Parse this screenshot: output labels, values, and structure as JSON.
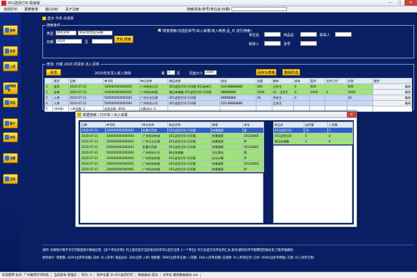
{
  "window": {
    "title": "451送货打印-极速版",
    "minimize": "—",
    "maximize": "□",
    "close": "✕"
  },
  "menu": {
    "items": [
      "当前打印",
      "报表帐单",
      "窗口(W)",
      "关于注册"
    ],
    "search_label": "搜索货单(单号/单位名/日期)"
  },
  "sidebar": {
    "items": [
      "查单",
      "发货",
      "入货",
      "销售报表",
      "货品",
      "客户",
      "供货",
      "设置",
      "注册"
    ]
  },
  "breadcrumb": "显示 今年 出货单",
  "filter": {
    "legend": "搜索条件",
    "type_label": "类型",
    "type_value": "所有货单",
    "keyword_placeholder": "单号/单位名/日期",
    "date_label": "日期",
    "date_from": "2020",
    "date_to_label": "至",
    "date_to": "",
    "search_button": "开始 搜索",
    "right_checkbox": "✓",
    "right_hint": "随意搜索(勾选后单号/出入库量/收入等按 品_日 进行搜索)",
    "unit_label": "单位名",
    "unit_value": "",
    "phone_label": "联系人",
    "phone_value": "",
    "goods_label": "商品名",
    "goods_value": "",
    "maker_label": "制单人",
    "maker_value": "",
    "remark_label": "货号",
    "remark_value": ""
  },
  "list": {
    "legend": "查找: 日期 2020 的货单 出入货单",
    "all_button": "全选",
    "page_info": "2020年年货入新入物资",
    "page_label": "第",
    "page_value": "1",
    "page_unit": "页",
    "page_size_label": "页面大小",
    "page_size_value": "2000",
    "export_button": "另存为表格",
    "delete_button": "删除所选",
    "columns": [
      "",
      "类型",
      "日期",
      "单号码",
      "单位名称",
      "商品名称",
      "地址",
      "金额",
      "制单",
      "成本",
      "盈利",
      "应付已付",
      "欠款",
      "操作"
    ],
    "rows": [
      {
        "idx": "1",
        "type": "出库",
        "date": "2020-07-21",
        "no": "100000000000003",
        "unit": "广州科技公司",
        "goods": "451送货打印-打印版-451送单打",
        "addr": "020-88888888",
        "amount": "600",
        "maker": "王先生",
        "cost": "0",
        "profit": "600",
        "paid": "",
        "owe": "600",
        "op": "编改"
      },
      {
        "idx": "2",
        "type": "出库",
        "date": "2020-07-21",
        "no": "100000000000002",
        "unit": "广州科技有限",
        "goods": "笔记本电脑 451送货打印-打印版",
        "addr": "88888888",
        "amount": "3400",
        "maker": "刘... 王先生",
        "cost": "0",
        "profit": "3400",
        "paid": "0",
        "owe": "3400",
        "op": "编改"
      },
      {
        "idx": "3",
        "type": "入库",
        "date": "2020-07-21",
        "no": "500000000000003",
        "unit": "广州天达光源",
        "goods": "451送货打印-打印版",
        "addr": "88888888",
        "amount": "30",
        "maker": "李先生",
        "cost": "0",
        "profit": "",
        "paid": "",
        "owe": "30",
        "op": "编改"
      },
      {
        "idx": "4",
        "type": "入库",
        "date": "2020-07-21",
        "no": "500000000000004",
        "unit": "广州科技公司",
        "goods": "451送货打印-打印版",
        "addr": "020-88888888",
        "amount": "",
        "maker": "王先生",
        "cost": "",
        "profit": "",
        "paid": "",
        "owe": "",
        "op": "编改"
      },
      {
        "idx": "5",
        "type": "(共4条)",
        "date": "入库总数: 2",
        "no": "出货总数: 4000",
        "unit": "欠数总计: 0",
        "goods": "",
        "addr": "",
        "amount": "",
        "maker": "",
        "cost": "",
        "profit": "",
        "paid": "",
        "owe": "",
        "op": ""
      }
    ]
  },
  "popup": {
    "title": "数据搜索 / 打印单 / 出入库量",
    "close": "✕",
    "columns": [
      "日期",
      "单号码",
      "单位名称",
      "商品名称",
      "规格",
      "单位"
    ],
    "rows": [
      {
        "date": "2020-07-21",
        "no": "100000000000003",
        "unit": "彩墨大药房",
        "goods": "451送货打印-打印版",
        "spec": "快捷搜索",
        "u": "盒"
      },
      {
        "date": "2020-07-21",
        "no": "100000000000004",
        "unit": "广州科技有限",
        "goods": "451送货打印-打印版",
        "spec": "快捷搜索",
        "u": "20110805"
      },
      {
        "date": "2020-07-21",
        "no": "100000000000002",
        "unit": "广州天达光源",
        "goods": "451送货打印-打印版",
        "spec": "快捷搜索",
        "u": "件"
      },
      {
        "date": "2020-07-21",
        "no": "500000000000003",
        "unit": "彩墨大药房",
        "goods": "451送货打印-打印版",
        "spec": "快捷搜索",
        "u": "20120805"
      },
      {
        "date": "2020-07-21",
        "no": "500000000000004",
        "unit": "广州科技公司",
        "goods": "笔记本电脑",
        "spec": "记忆保存",
        "u": "套"
      },
      {
        "date": "2020-07-21",
        "no": "100000000000002",
        "unit": "广州科技有限",
        "goods": "451送货打印-打印版",
        "spec": "自动计算",
        "u": "件"
      },
      {
        "date": "2020-07-21",
        "no": "100000000000001",
        "unit": "广州科技有限",
        "goods": "451送货打印-打印版",
        "spec": "快捷搜索",
        "u": "20120805"
      },
      {
        "date": "2020-07-21",
        "no": "100000000000001",
        "unit": "广州科技有限",
        "goods": "451送货打印-打印版",
        "spec": "快捷搜索",
        "u": "件"
      }
    ],
    "side_columns": [
      "商品名",
      "出货量",
      "入货量"
    ],
    "side_rows": [
      {
        "name": "451送货打印",
        "out": "15",
        "in": "1"
      },
      {
        "name": "451送货打印",
        "out": "5",
        "in": "0"
      },
      {
        "name": "笔记本电脑",
        "out": "1",
        "in": "0"
      }
    ]
  },
  "info": {
    "line1": "说明: 如果统计数字为空可能是统计数据出错,【多个单位名称】时上面仅显示当前查找货单可以显示出来【一个单位】时只会显示该单位的汇总;查询:删除货单不能算回回收站里,只能单独删除",
    "line2": "财务统计:  销售额: 4200(出库单金额)   成本: 0(入库单)   商品总价: 300(出库-入库)   销售额: 3900(出库单已收)   入库额: 300(入库单金额)   应收款: 0(入库单应付)   已付: 4000(出库单预收)   欠款: 0(入库单欠款)"
  },
  "status": {
    "items": [
      "欢迎使用 标识: 广州推荐打印科技",
      "当前版本 管理员",
      "积分: 0",
      "软件位置 D:\\451送货打印",
      "数据备份 成功",
      "文件名 最新数据备份.dat"
    ]
  }
}
